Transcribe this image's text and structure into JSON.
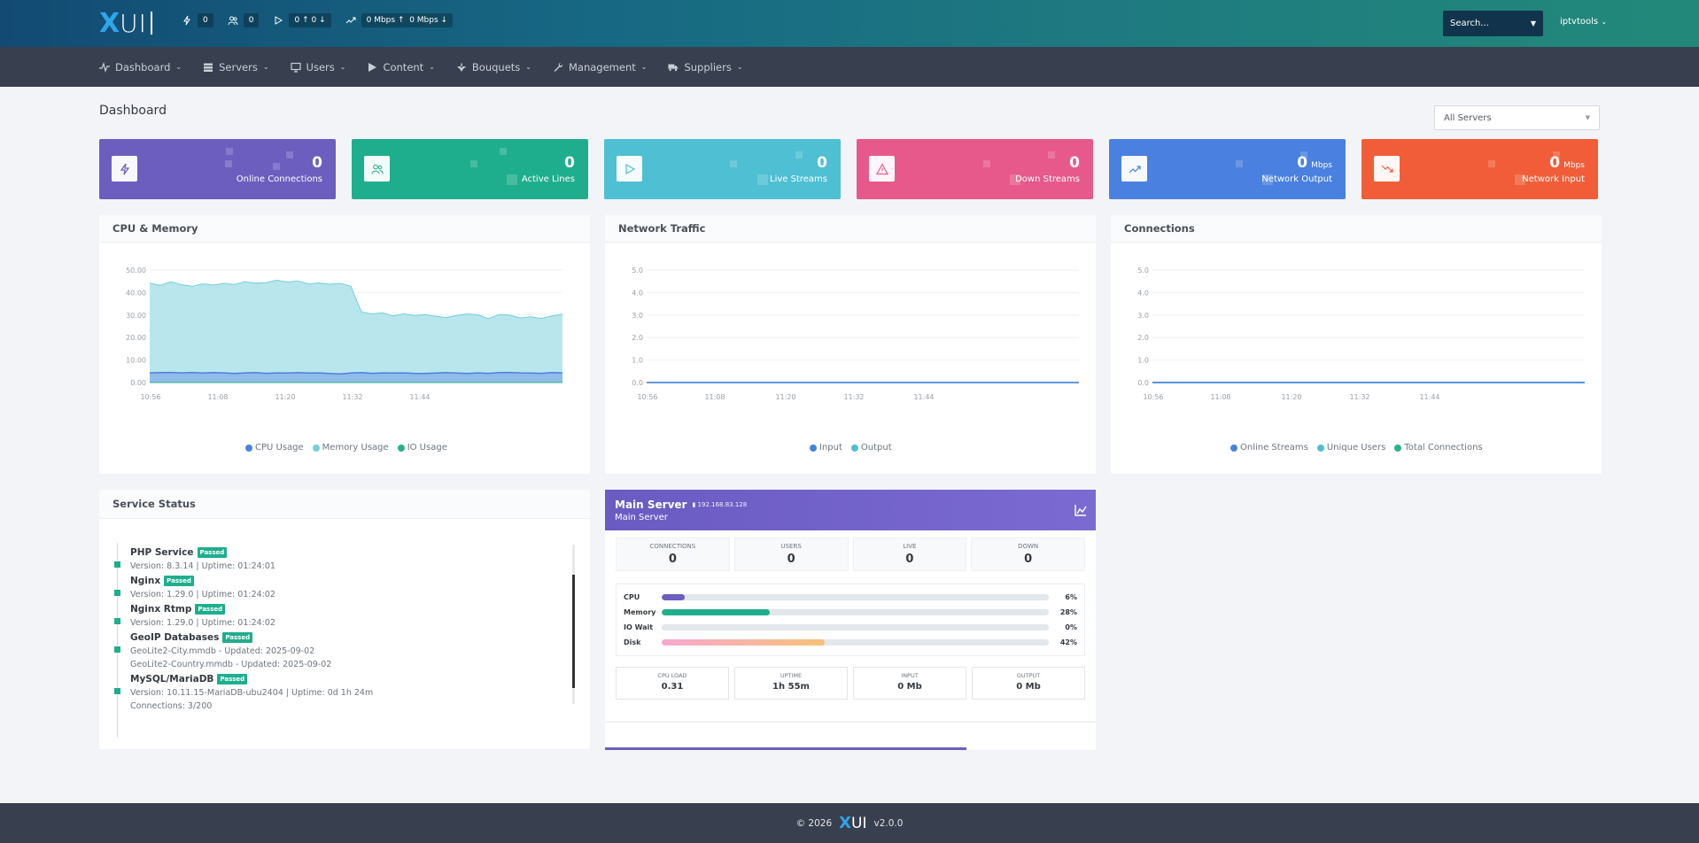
{
  "brand": {
    "logo_x": "X",
    "logo_ui": "UI"
  },
  "topbar": {
    "connections": "0",
    "users": "0",
    "streams_up": "0",
    "streams_down": "0",
    "bandwidth_up": "0 Mbps",
    "bandwidth_down": "0 Mbps",
    "search_placeholder": "Search...",
    "username": "iptvtools"
  },
  "nav": [
    {
      "label": "Dashboard",
      "icon": "pulse-icon"
    },
    {
      "label": "Servers",
      "icon": "servers-icon"
    },
    {
      "label": "Users",
      "icon": "monitor-icon"
    },
    {
      "label": "Content",
      "icon": "play-icon"
    },
    {
      "label": "Bouquets",
      "icon": "flower-icon"
    },
    {
      "label": "Management",
      "icon": "wrench-icon"
    },
    {
      "label": "Suppliers",
      "icon": "truck-icon"
    }
  ],
  "page": {
    "title": "Dashboard",
    "server_select": "All Servers"
  },
  "cards": [
    {
      "value": "0",
      "unit": "",
      "label": "Online Connections",
      "color": "#6c5ebf"
    },
    {
      "value": "0",
      "unit": "",
      "label": "Active Lines",
      "color": "#1fae8d"
    },
    {
      "value": "0",
      "unit": "",
      "label": "Live Streams",
      "color": "#4fbfd3"
    },
    {
      "value": "0",
      "unit": "",
      "label": "Down Streams",
      "color": "#e7598a"
    },
    {
      "value": "0",
      "unit": "Mbps",
      "label": "Network Output",
      "color": "#4a81e0"
    },
    {
      "value": "0",
      "unit": "Mbps",
      "label": "Network Input",
      "color": "#f15d38"
    }
  ],
  "panels": {
    "cpu_memory": "CPU & Memory",
    "network": "Network Traffic",
    "connections": "Connections",
    "service_status": "Service Status"
  },
  "chart_data": [
    {
      "type": "area",
      "title": "CPU & Memory",
      "x_ticks": [
        "10:56",
        "11:08",
        "11:20",
        "11:32",
        "11:44"
      ],
      "y_ticks": [
        "0.00",
        "10.00",
        "20.00",
        "30.00",
        "40.00",
        "50.00"
      ],
      "ylim": [
        0,
        50
      ],
      "series": [
        {
          "name": "CPU Usage",
          "color": "#4a81e0",
          "values": [
            4.3,
            4.4,
            4.5,
            4.3,
            4.5,
            4.2,
            4.4,
            4.3,
            4.0,
            4.3,
            4.4,
            4.1,
            4.3,
            4.2,
            4.4,
            4.2,
            4.3,
            4.0,
            3.8,
            4.2,
            4.4,
            4.1,
            4.3,
            4.2,
            4.3,
            4.1,
            4.0,
            4.2,
            4.4,
            4.2,
            4.0,
            4.3,
            4.1,
            4.4,
            4.5,
            4.3,
            4.2,
            4.1,
            4.4,
            4.3
          ]
        },
        {
          "name": "Memory Usage",
          "color": "#72cfdb",
          "values": [
            44.2,
            43.2,
            44.8,
            43.5,
            42.8,
            43.9,
            43.3,
            44.1,
            43.6,
            44.9,
            44.2,
            44.4,
            45.5,
            44.7,
            45.2,
            43.8,
            44.3,
            43.7,
            44.1,
            42.8,
            31.4,
            30.5,
            31.0,
            29.6,
            30.6,
            29.8,
            30.2,
            29.5,
            28.9,
            29.8,
            30.5,
            30.1,
            28.4,
            30.2,
            30.0,
            28.7,
            29.2,
            28.5,
            29.6,
            30.4
          ]
        },
        {
          "name": "IO Usage",
          "color": "#27b28e",
          "values": [
            0,
            0,
            0,
            0,
            0,
            0,
            0,
            0,
            0,
            0,
            0,
            0,
            0,
            0,
            0,
            0,
            0,
            0,
            0,
            0,
            0,
            0,
            0,
            0,
            0,
            0,
            0,
            0,
            0,
            0,
            0,
            0,
            0,
            0,
            0,
            0,
            0,
            0,
            0,
            0
          ]
        }
      ]
    },
    {
      "type": "line",
      "title": "Network Traffic",
      "x_ticks": [
        "10:56",
        "11:08",
        "11:20",
        "11:32",
        "11:44"
      ],
      "y_ticks": [
        "0.0",
        "1.0",
        "2.0",
        "3.0",
        "4.0",
        "5.0"
      ],
      "ylim": [
        0,
        5
      ],
      "series": [
        {
          "name": "Input",
          "color": "#4a81e0",
          "values": [
            0,
            0,
            0,
            0,
            0
          ]
        },
        {
          "name": "Output",
          "color": "#4fbfd3",
          "values": [
            0,
            0,
            0,
            0,
            0
          ]
        }
      ]
    },
    {
      "type": "line",
      "title": "Connections",
      "x_ticks": [
        "10:56",
        "11:08",
        "11:20",
        "11:32",
        "11:44"
      ],
      "y_ticks": [
        "0.0",
        "1.0",
        "2.0",
        "3.0",
        "4.0",
        "5.0"
      ],
      "ylim": [
        0,
        5
      ],
      "series": [
        {
          "name": "Online Streams",
          "color": "#4a81e0",
          "values": [
            0,
            0,
            0,
            0,
            0
          ]
        },
        {
          "name": "Unique Users",
          "color": "#4fbfd3",
          "values": [
            0,
            0,
            0,
            0,
            0
          ]
        },
        {
          "name": "Total Connections",
          "color": "#27b28e",
          "values": [
            0,
            0,
            0,
            0,
            0
          ]
        }
      ]
    }
  ],
  "services": [
    {
      "name": "PHP Service",
      "badge": "Passed",
      "lines": [
        "Version: 8.3.14 | Uptime: 01:24:01"
      ]
    },
    {
      "name": "Nginx",
      "badge": "Passed",
      "lines": [
        "Version: 1.29.0 | Uptime: 01:24:02"
      ]
    },
    {
      "name": "Nginx Rtmp",
      "badge": "Passed",
      "lines": [
        "Version: 1.29.0 | Uptime: 01:24:02"
      ]
    },
    {
      "name": "GeoIP Databases",
      "badge": "Passed",
      "lines": [
        "GeoLite2-City.mmdb - Updated: 2025-09-02",
        "GeoLite2-Country.mmdb - Updated: 2025-09-02"
      ]
    },
    {
      "name": "MySQL/MariaDB",
      "badge": "Passed",
      "lines": [
        "Version: 10.11.15-MariaDB-ubu2404 | Uptime: 0d 1h 24m",
        "Connections: 3/200"
      ]
    }
  ],
  "main_server": {
    "title": "Main Server",
    "ip": "192.168.83.128",
    "subtitle": "Main Server",
    "stats": [
      {
        "label": "CONNECTIONS",
        "value": "0"
      },
      {
        "label": "USERS",
        "value": "0"
      },
      {
        "label": "LIVE",
        "value": "0"
      },
      {
        "label": "DOWN",
        "value": "0"
      }
    ],
    "usage": [
      {
        "label": "CPU",
        "percent": 6,
        "value": "6%",
        "color": "#6c5ebf"
      },
      {
        "label": "Memory",
        "percent": 28,
        "value": "28%",
        "color": "#1fae8d"
      },
      {
        "label": "IO Wait",
        "percent": 0,
        "value": "0%",
        "color": "#4fbfd3"
      },
      {
        "label": "Disk",
        "percent": 42,
        "value": "42%",
        "color": "#f7b766"
      }
    ],
    "metrics": [
      {
        "label": "CPU LOAD",
        "value": "0.31"
      },
      {
        "label": "UPTIME",
        "value": "1h 55m"
      },
      {
        "label": "INPUT",
        "value": "0 Mb"
      },
      {
        "label": "OUTPUT",
        "value": "0 Mb"
      }
    ]
  },
  "footer": {
    "copyright": "© 2026",
    "version": "v2.0.0"
  }
}
